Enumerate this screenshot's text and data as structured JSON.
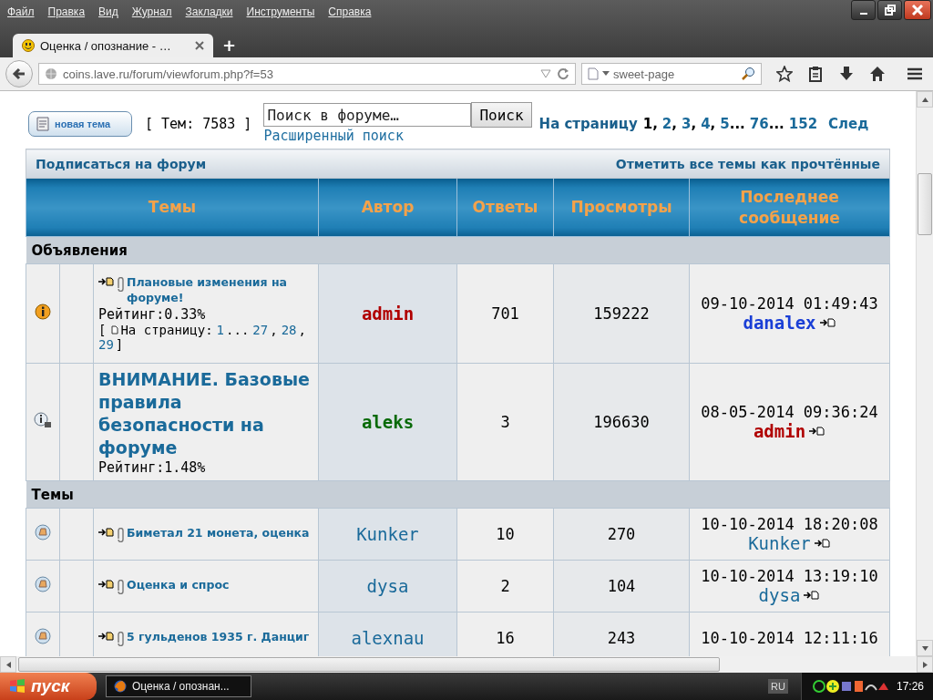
{
  "menu": [
    "Файл",
    "Правка",
    "Вид",
    "Журнал",
    "Закладки",
    "Инструменты",
    "Справка"
  ],
  "tabs": [
    {
      "label": "Оценка / опознание - …",
      "selected": true
    }
  ],
  "new_tab": "+",
  "address": "coins.lave.ru/forum/viewforum.php?f=53",
  "search_engine": {
    "value": "sweet-page"
  },
  "forum": {
    "new_topic_button": "новая тема",
    "topic_count": "[ Тем: 7583 ]",
    "search": {
      "placeholder": "Поиск в форуме…",
      "button": "Поиск",
      "advanced": "Расширенный поиск"
    },
    "pagination": {
      "label": "На страницу",
      "items": [
        {
          "kind": "page",
          "label": "1",
          "selected": true
        },
        {
          "kind": "sep",
          "label": ","
        },
        {
          "kind": "page",
          "label": "2",
          "selected": false
        },
        {
          "kind": "sep",
          "label": ","
        },
        {
          "kind": "page",
          "label": "3",
          "selected": false
        },
        {
          "kind": "sep",
          "label": ","
        },
        {
          "kind": "page",
          "label": "4",
          "selected": false
        },
        {
          "kind": "sep",
          "label": ","
        },
        {
          "kind": "page",
          "label": "5",
          "selected": false
        },
        {
          "kind": "sep",
          "label": "..."
        },
        {
          "kind": "page",
          "label": "76",
          "selected": false
        },
        {
          "kind": "sep",
          "label": "..."
        },
        {
          "kind": "page",
          "label": "152",
          "selected": false
        }
      ],
      "next": "След"
    },
    "subscribe": "Подписаться на форум",
    "mark_read": "Отметить все темы как прочтённые",
    "columns": [
      "Темы",
      "Автор",
      "Ответы",
      "Просмотры",
      "Последнее сообщение"
    ],
    "sections": [
      {
        "title": "Объявления",
        "rows": [
          {
            "kind": "announce",
            "title": "Плановые изменения на форуме!",
            "attachment": true,
            "rating": "Рейтинг:0.33%",
            "pages_open": "[",
            "pages_label": "На страницу:",
            "pages": [
              {
                "kind": "page",
                "label": "1"
              },
              {
                "kind": "sep",
                "label": "..."
              },
              {
                "kind": "page",
                "label": "27"
              },
              {
                "kind": "sep",
                "label": ","
              },
              {
                "kind": "page",
                "label": "28"
              },
              {
                "kind": "sep",
                "label": ","
              },
              {
                "kind": "page",
                "label": "29"
              }
            ],
            "pages_close": "]",
            "author": {
              "name": "admin",
              "color": "#b00000",
              "bold": true
            },
            "replies": "701",
            "views": "159222",
            "last": {
              "date": "09-10-2014 01:49:43",
              "author": {
                "name": "danalex",
                "color": "#1a3fd6",
                "bold": true
              }
            }
          },
          {
            "kind": "global",
            "title": "ВНИМАНИЕ. Базовые правила безопасности на форуме",
            "attachment": false,
            "rating": "Рейтинг:1.48%",
            "author": {
              "name": "aleks",
              "color": "#086a08",
              "bold": true
            },
            "replies": "3",
            "views": "196630",
            "last": {
              "date": "08-05-2014 09:36:24",
              "author": {
                "name": "admin",
                "color": "#b00000",
                "bold": true
              }
            }
          }
        ]
      },
      {
        "title": "Темы",
        "rows": [
          {
            "kind": "topic",
            "title": "Биметал 21 монета, оценка",
            "attachment": true,
            "author": {
              "name": "Kunker",
              "color": "#1a6a9a",
              "bold": false
            },
            "replies": "10",
            "views": "270",
            "last": {
              "date": "10-10-2014 18:20:08",
              "author": {
                "name": "Kunker",
                "color": "#1a6a9a",
                "bold": false
              }
            }
          },
          {
            "kind": "topic",
            "title": "Оценка и спрос",
            "attachment": true,
            "author": {
              "name": "dysa",
              "color": "#1a6a9a",
              "bold": false
            },
            "replies": "2",
            "views": "104",
            "last": {
              "date": "10-10-2014 13:19:10",
              "author": {
                "name": "dysa",
                "color": "#1a6a9a",
                "bold": false
              }
            }
          },
          {
            "kind": "topic",
            "title": "5 гульденов 1935 г. Данциг",
            "attachment": true,
            "author": {
              "name": "alexnau",
              "color": "#1a6a9a",
              "bold": false
            },
            "replies": "16",
            "views": "243",
            "last": {
              "date": "10-10-2014 12:11:16"
            }
          }
        ]
      }
    ]
  },
  "taskbar": {
    "start": "пуск",
    "tasks": [
      {
        "label": "Оценка / опознан...",
        "selected": true
      }
    ],
    "language": "RU",
    "clock": "17:26"
  }
}
